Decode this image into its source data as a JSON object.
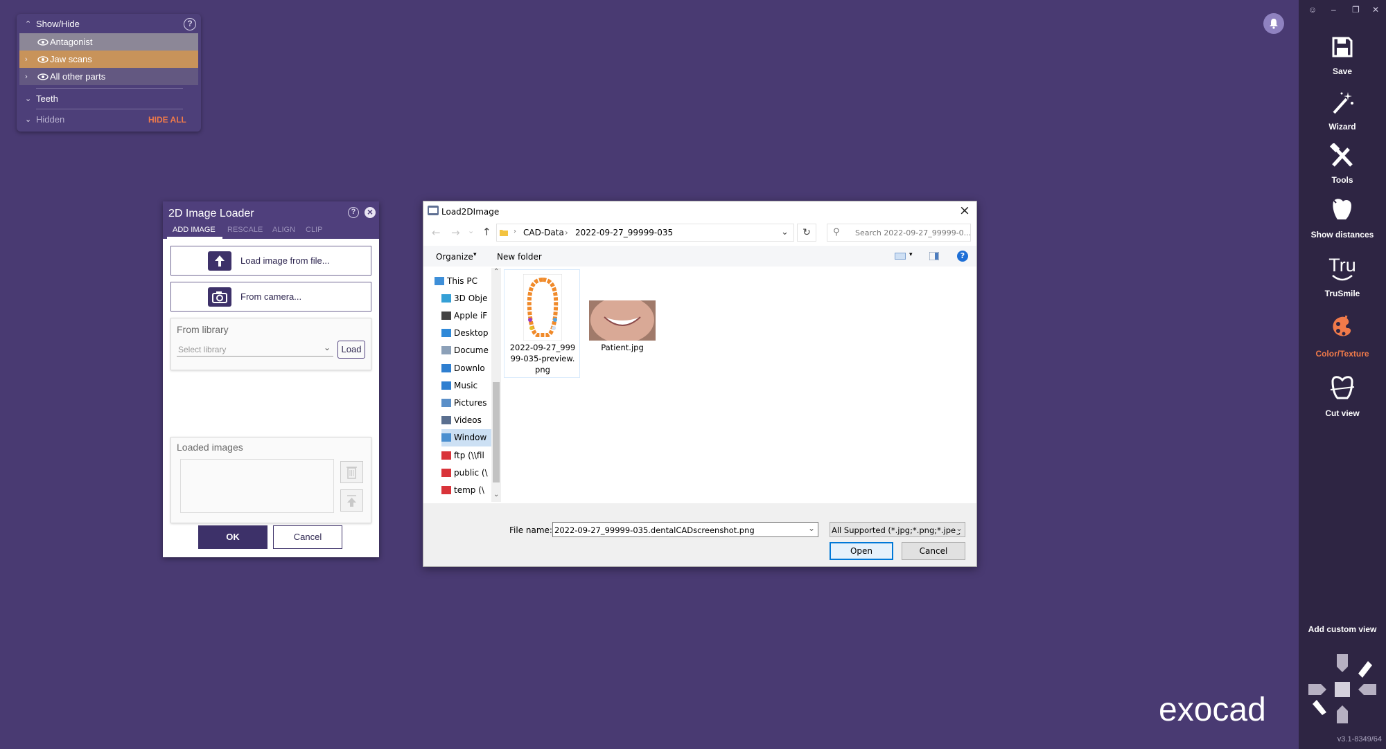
{
  "show_hide": {
    "title": "Show/Hide",
    "help_icon": "?",
    "items": [
      {
        "label": "Antagonist"
      },
      {
        "label": "Jaw scans"
      },
      {
        "label": "All other parts"
      }
    ],
    "teeth_label": "Teeth",
    "hidden_label": "Hidden",
    "hide_all_label": "HIDE ALL"
  },
  "loader": {
    "title": "2D Image Loader",
    "help_icon": "?",
    "close_icon": "×",
    "tabs": [
      "ADD IMAGE",
      "RESCALE",
      "ALIGN",
      "CLIP"
    ],
    "load_file_label": "Load image from file...",
    "camera_label": "From camera...",
    "library_title": "From library",
    "library_placeholder": "Select library",
    "library_load_label": "Load",
    "loaded_title": "Loaded images",
    "ok_label": "OK",
    "cancel_label": "Cancel"
  },
  "file_dialog": {
    "title": "Load2DImage",
    "breadcrumb": [
      "CAD-Data",
      "2022-09-27_99999-035"
    ],
    "search_placeholder": "Search 2022-09-27_99999-0...",
    "organize_label": "Organize",
    "new_folder_label": "New folder",
    "tree": [
      {
        "label": "This PC",
        "icon": "pc-icon"
      },
      {
        "label": "3D Obje",
        "icon": "3d-objects-icon"
      },
      {
        "label": "Apple iF",
        "icon": "apple-icon"
      },
      {
        "label": "Desktop",
        "icon": "desktop-icon"
      },
      {
        "label": "Docume",
        "icon": "documents-icon"
      },
      {
        "label": "Downlo",
        "icon": "downloads-icon"
      },
      {
        "label": "Music",
        "icon": "music-icon"
      },
      {
        "label": "Pictures",
        "icon": "pictures-icon"
      },
      {
        "label": "Videos",
        "icon": "videos-icon"
      },
      {
        "label": "Window",
        "icon": "windows-drive-icon"
      },
      {
        "label": "ftp (\\\\fil",
        "icon": "network-drive-icon"
      },
      {
        "label": "public (\\",
        "icon": "network-drive-icon"
      },
      {
        "label": "temp (\\",
        "icon": "network-drive-icon"
      }
    ],
    "files": [
      {
        "name": "2022-09-27_999\n99-035-preview.\npng"
      },
      {
        "name": "Patient.jpg"
      }
    ],
    "file_name_label": "File name:",
    "file_name_value": "2022-09-27_99999-035.dentalCADscreenshot.png",
    "filter_value": "All Supported (*.jpg;*.png;*.jpeg",
    "open_label": "Open",
    "cancel_label": "Cancel"
  },
  "sidebar": {
    "items": [
      {
        "label": "Save",
        "icon": "save-icon"
      },
      {
        "label": "Wizard",
        "icon": "wizard-icon"
      },
      {
        "label": "Tools",
        "icon": "tools-icon"
      },
      {
        "label": "Show distances",
        "icon": "distances-icon"
      },
      {
        "label": "TruSmile",
        "icon": "trusmile-icon"
      },
      {
        "label": "Color/Texture",
        "icon": "palette-icon"
      },
      {
        "label": "Cut view",
        "icon": "cut-view-icon"
      }
    ],
    "add_custom_view": "Add custom view",
    "version": "v3.1-8349/64"
  },
  "brand": "exocad",
  "colors": {
    "background": "#493a72",
    "sidebar": "#2e2543",
    "accent_orange": "#f07a4a",
    "highlight_jaw": "#c8935a"
  }
}
